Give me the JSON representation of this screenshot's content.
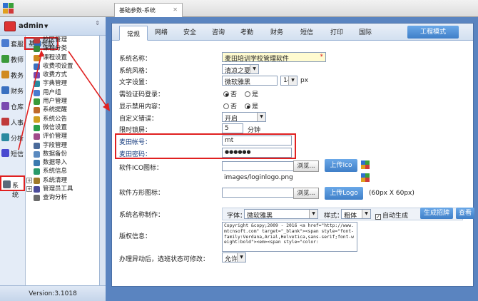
{
  "window": {
    "tab_title": "基础参数-系统",
    "tab_close": "✕"
  },
  "user": {
    "name": "admin",
    "caret": "▼",
    "pin": "⇕"
  },
  "modules": [
    {
      "label": "套服",
      "color": "#4a7bd0"
    },
    {
      "label": "教师",
      "color": "#3a9a3a"
    },
    {
      "label": "教务",
      "color": "#d08a20"
    },
    {
      "label": "财务",
      "color": "#3a70c0"
    },
    {
      "label": "仓库",
      "color": "#7a4ab0"
    },
    {
      "label": "人事",
      "color": "#c03a3a"
    },
    {
      "label": "分析",
      "color": "#2a8aa0"
    },
    {
      "label": "短信",
      "color": "#4a4ad0"
    },
    {
      "label": "系统",
      "color": "#5a6a7a"
    }
  ],
  "tree": [
    {
      "label": "基础参数",
      "color": "#2a6ac0",
      "expand": ""
    },
    {
      "label": "校区管理",
      "color": "#c03a3a",
      "expand": ""
    },
    {
      "label": "课程分类",
      "color": "#3a8a3a",
      "expand": ""
    },
    {
      "label": "课程设置",
      "color": "#d08a20",
      "expand": ""
    },
    {
      "label": "收费项设置",
      "color": "#3a70c0",
      "expand": ""
    },
    {
      "label": "收费方式",
      "color": "#7a4ab0",
      "expand": ""
    },
    {
      "label": "字典管理",
      "color": "#2a8aa0",
      "expand": ""
    },
    {
      "label": "用户组",
      "color": "#4a7bd0",
      "expand": ""
    },
    {
      "label": "用户管理",
      "color": "#3a9a3a",
      "expand": ""
    },
    {
      "label": "系统提醒",
      "color": "#c06a2a",
      "expand": ""
    },
    {
      "label": "系统公告",
      "color": "#d0a020",
      "expand": ""
    },
    {
      "label": "微信设置",
      "color": "#2aa04a",
      "expand": ""
    },
    {
      "label": "评价管理",
      "color": "#a04a8a",
      "expand": ""
    },
    {
      "label": "字段管理",
      "color": "#4a6a9a",
      "expand": ""
    },
    {
      "label": "数据备份",
      "color": "#5a8ac0",
      "expand": ""
    },
    {
      "label": "数据导入",
      "color": "#3a7ab0",
      "expand": ""
    },
    {
      "label": "系统信息",
      "color": "#2a9a6a",
      "expand": ""
    },
    {
      "label": "系统清理",
      "color": "#a07a2a",
      "expand": "+"
    },
    {
      "label": "管理员工具",
      "color": "#4a4a9a",
      "expand": "+"
    },
    {
      "label": "查询分析",
      "color": "#6a6a6a",
      "expand": ""
    }
  ],
  "version": "Version:3.1018",
  "tabs": [
    "常规",
    "网络",
    "安全",
    "咨询",
    "考勤",
    "财务",
    "短信",
    "打印",
    "国际"
  ],
  "mode_button": "工程模式",
  "form": {
    "system_name_label": "系统名称：",
    "system_name_value": "麦田培训学校管理软件",
    "required_mark": "*",
    "style_label": "系统风格：",
    "style_value": "清凉之夏",
    "font_label": "文字设置：",
    "font_value": "微软雅黑",
    "font_size": "14",
    "font_unit": "px",
    "captcha_label": "需验证码登录：",
    "captcha_no": "否",
    "captcha_yes": "是",
    "disabled_label": "显示禁用内容：",
    "disabled_no": "否",
    "disabled_yes": "是",
    "error_label": "自定义错误：",
    "error_value": "开启",
    "lock_label": "限时锁屏：",
    "lock_value": "5",
    "lock_unit": "分钟",
    "mt_account_label": "麦田帐号：",
    "mt_account_value": "mt",
    "mt_password_label": "麦田密码：",
    "mt_password_value": "●●●●●●",
    "ico_label": "软件ICO图标：",
    "browse": "浏览...",
    "upload_ico": "上传Ico",
    "square_label": "软件方形图标：",
    "square_value": "images/loginlogo.png",
    "upload_logo": "上传Logo",
    "logo_size": "(60px X 60px)",
    "make_label": "系统名称制作：",
    "font_word": "字体：",
    "make_font": "微软雅黑",
    "style_word": "样式：",
    "make_style": "粗体",
    "auto_gen": "自动生成",
    "gen_button": "生成招牌",
    "view_button": "查看",
    "copyright_label": "版权信息：",
    "copyright_code": "Copyright &copy;2009 - 2016 <a href=\"http://www.mtcnsoft.com\" target=\"_blank\"><span style=\"font-family:Verdana,Arial,Helvetica,sans-serif;font-weight:bold\"><em><span style=\"color:",
    "transfer_label": "办理异动后，选班状态可修改：",
    "transfer_value": "允许"
  }
}
